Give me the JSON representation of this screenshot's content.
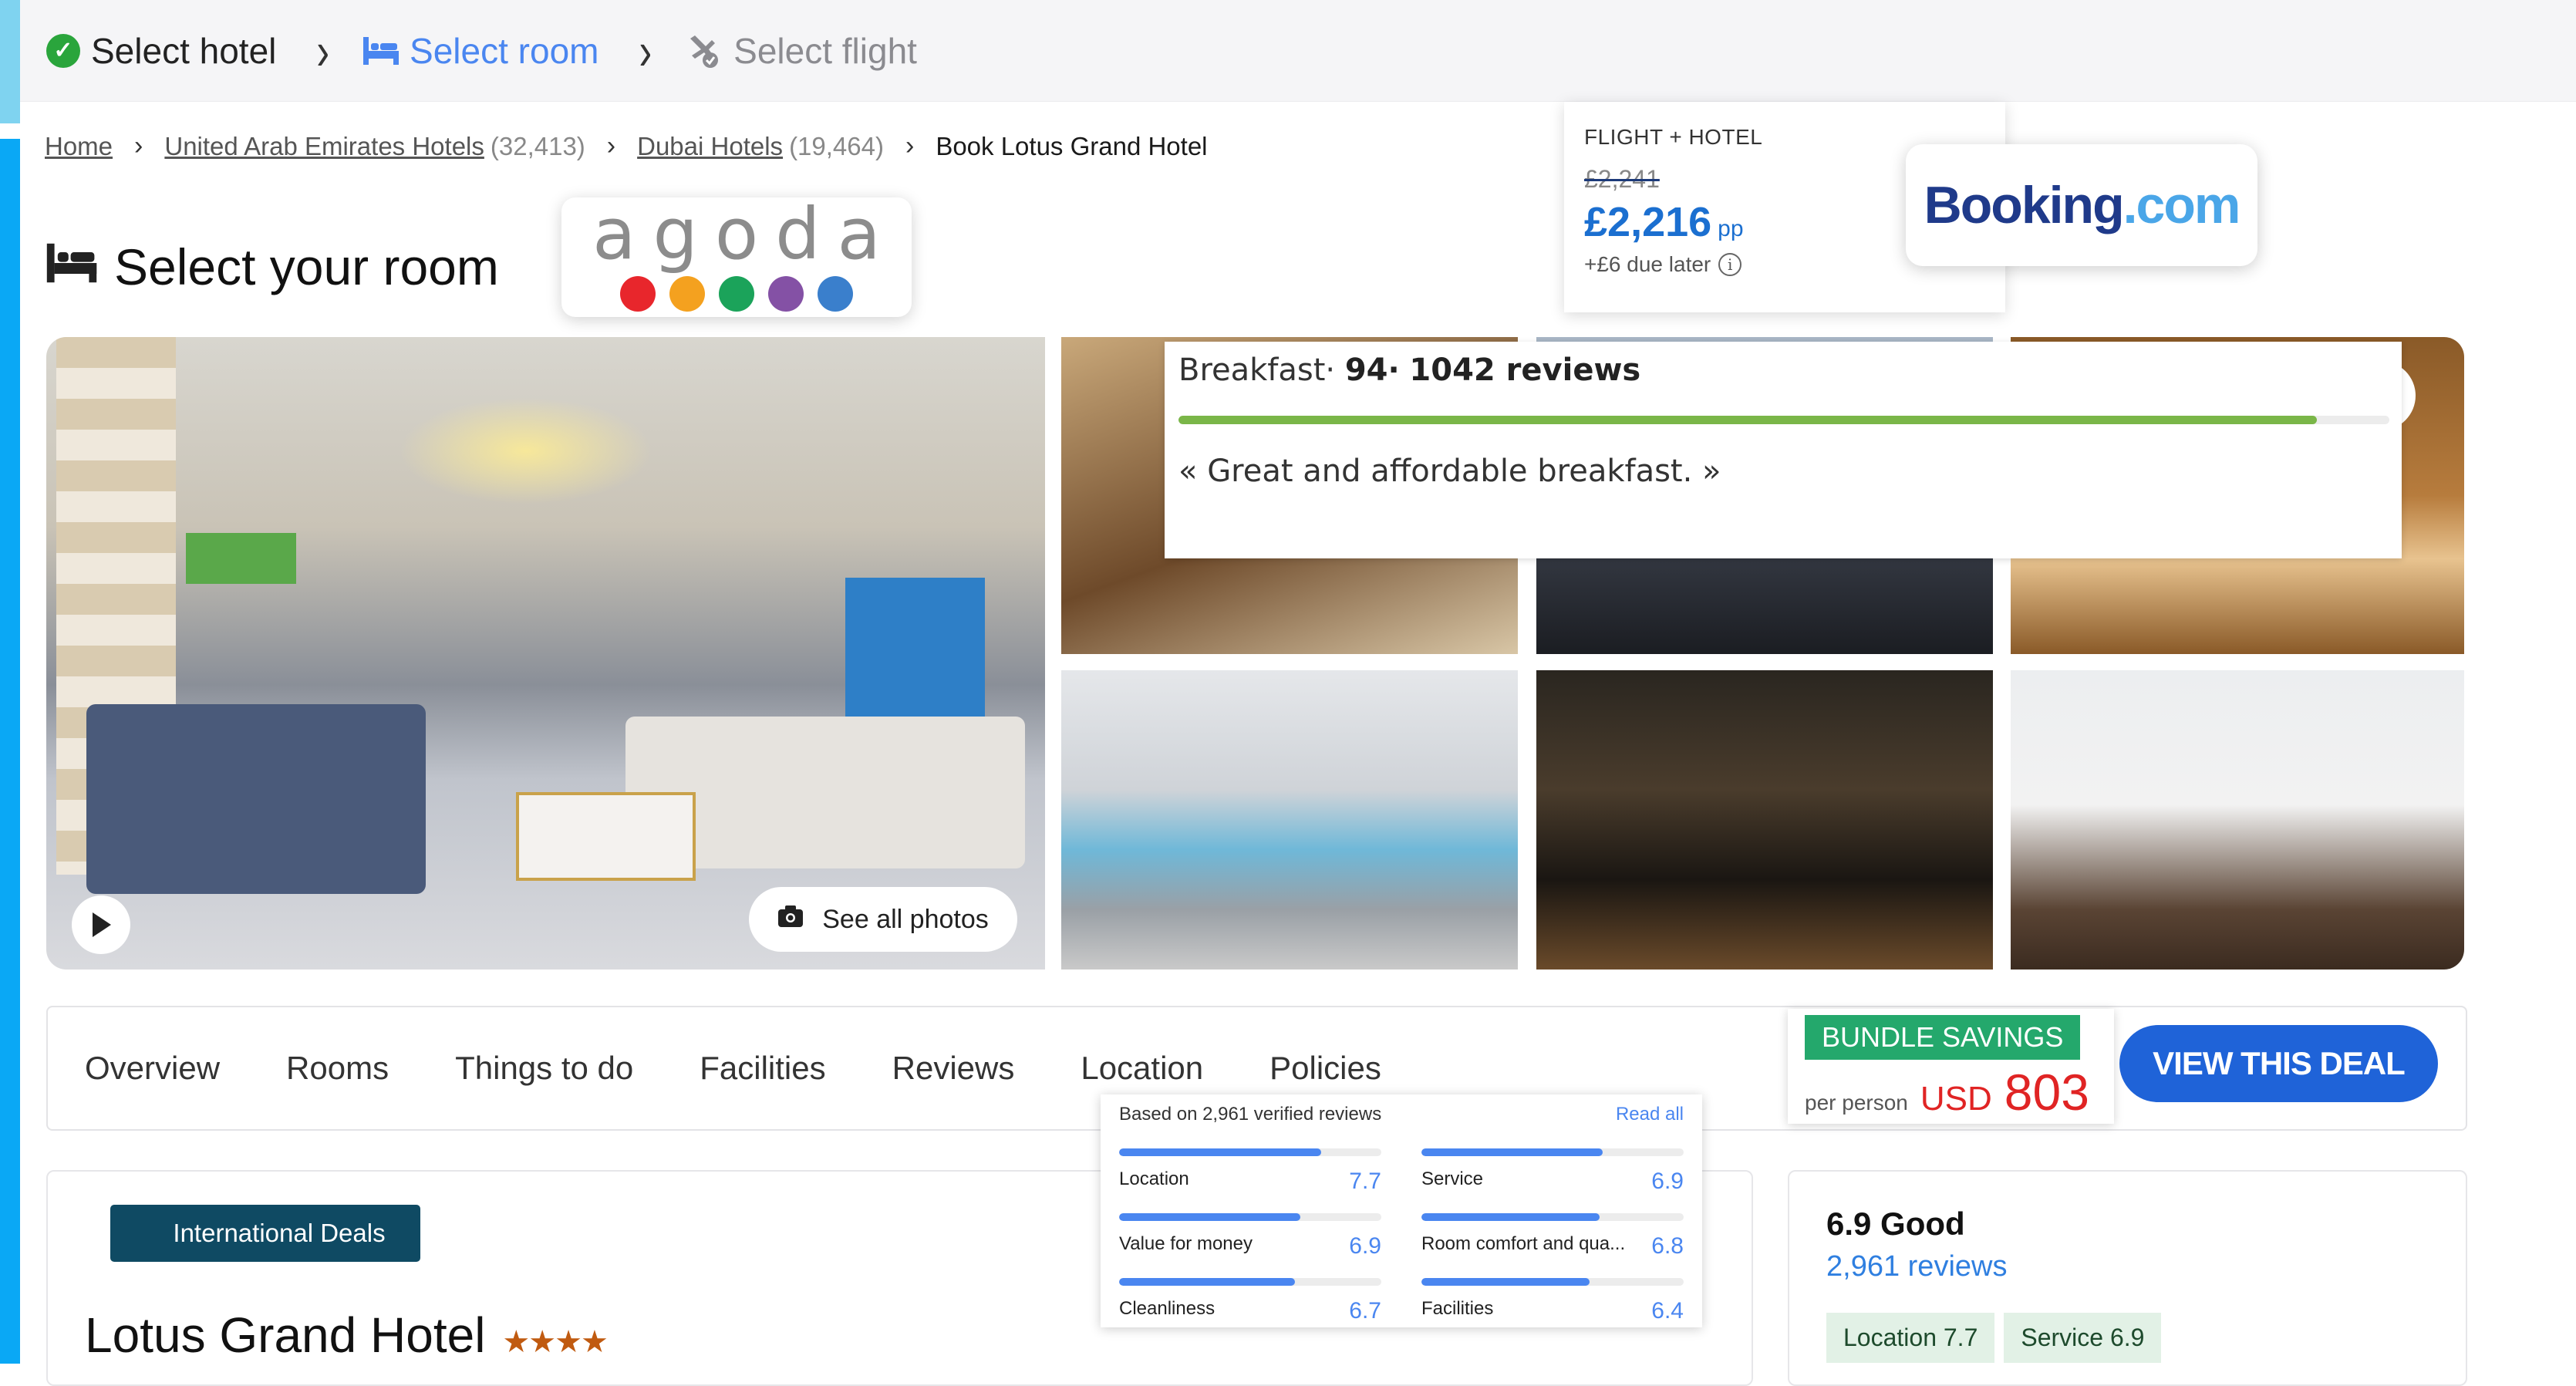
{
  "steps": [
    {
      "label": "Select hotel",
      "state": "done",
      "icon": "check-circle-icon"
    },
    {
      "label": "Select room",
      "state": "active",
      "icon": "bed-icon"
    },
    {
      "label": "Select flight",
      "state": "pending",
      "icon": "plane-icon"
    }
  ],
  "step_separator": "›",
  "breadcrumb": {
    "items": [
      {
        "label": "Home",
        "count": ""
      },
      {
        "label": "United Arab Emirates Hotels",
        "count": "(32,413)"
      },
      {
        "label": "Dubai Hotels",
        "count": "(19,464)"
      }
    ],
    "current": "Book Lotus Grand Hotel",
    "separator": "›"
  },
  "page_title": "Select your room",
  "agoda": {
    "wordmark": "agoda",
    "dot_colors": [
      "#e8262c",
      "#f4a11f",
      "#1ba35a",
      "#8451a5",
      "#3a7fcc"
    ]
  },
  "flight_hotel": {
    "label": "FLIGHT + HOTEL",
    "old_price": "£2,241",
    "price": "£2,216",
    "price_unit": "pp",
    "due_later": "+£6 due later",
    "info_glyph": "i"
  },
  "booking": {
    "part1": "Booking",
    "part2": ".com"
  },
  "gallery": {
    "see_all_label": "See all photos",
    "camera_glyph": "📷"
  },
  "breakfast_popup": {
    "category": "Breakfast·",
    "score": "94·",
    "reviews": "1042 reviews",
    "score_fraction": 0.94,
    "quote": "« Great and affordable breakfast. »"
  },
  "tabs": [
    "Overview",
    "Rooms",
    "Things to do",
    "Facilities",
    "Reviews",
    "Location",
    "Policies"
  ],
  "bundle": {
    "badge": "BUNDLE SAVINGS",
    "per_person": "per person",
    "currency": "USD",
    "amount": "803",
    "cta": "VIEW THIS DEAL"
  },
  "reviews_popup": {
    "based_on": "Based on 2,961 verified reviews",
    "read_all": "Read all",
    "categories": [
      {
        "name": "Location",
        "score": "7.7",
        "value": 7.7
      },
      {
        "name": "Service",
        "score": "6.9",
        "value": 6.9
      },
      {
        "name": "Value for money",
        "score": "6.9",
        "value": 6.9
      },
      {
        "name": "Room comfort and qua...",
        "score": "6.8",
        "value": 6.8
      },
      {
        "name": "Cleanliness",
        "score": "6.7",
        "value": 6.7
      },
      {
        "name": "Facilities",
        "score": "6.4",
        "value": 6.4
      }
    ],
    "max_score": 10
  },
  "hotel": {
    "badge": "International Deals",
    "name": "Lotus Grand Hotel",
    "stars": "★★★★",
    "star_count": 4
  },
  "rating": {
    "score_label": "6.9 Good",
    "reviews": "2,961 reviews",
    "chips": [
      "Location 7.7",
      "Service 6.9"
    ]
  }
}
